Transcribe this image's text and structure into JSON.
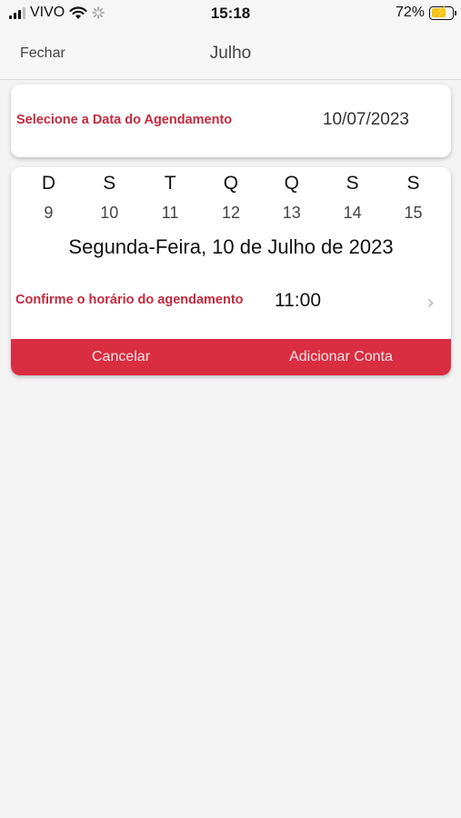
{
  "status_bar": {
    "carrier": "VIVO",
    "time": "15:18",
    "battery_percent": "72%",
    "battery_level": 0.72,
    "icons": [
      "signal-icon",
      "wifi-icon",
      "loading-icon",
      "battery-charging-icon"
    ]
  },
  "nav": {
    "close_label": "Fechar",
    "title": "Julho"
  },
  "date_card": {
    "label": "Selecione a Data do Agendamento",
    "value": "10/07/2023"
  },
  "picker": {
    "weekdays": [
      "D",
      "S",
      "T",
      "Q",
      "Q",
      "S",
      "S"
    ],
    "days": [
      "9",
      "10",
      "11",
      "12",
      "13",
      "14",
      "15"
    ],
    "selected_date": "Segunda-Feira, 10 de Julho de 2023",
    "time_label": "Confirme o horário do agendamento",
    "time_value": "11:00"
  },
  "actions": {
    "cancel_label": "Cancelar",
    "add_label": "Adicionar Conta"
  },
  "colors": {
    "accent": "#d92d41",
    "label_red": "#c42a3e",
    "background": "#f3f3f4"
  }
}
